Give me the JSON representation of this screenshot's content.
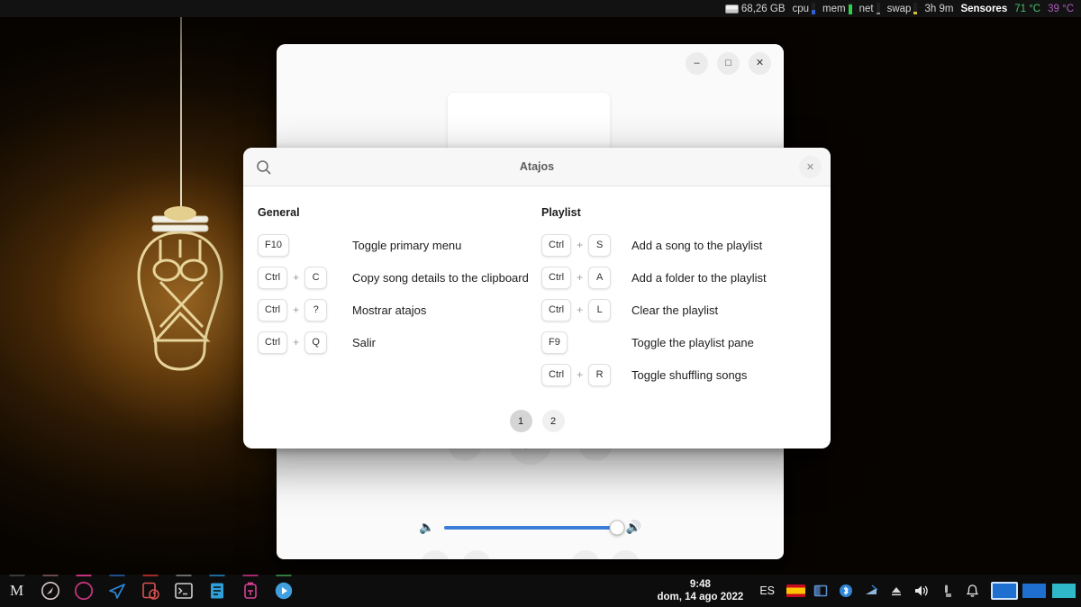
{
  "topbar": {
    "items": [
      {
        "name": "disk",
        "label": "68,26 GB",
        "color": "#d6d6d6",
        "bold": false,
        "graph": null
      },
      {
        "name": "cpu",
        "label": "cpu",
        "color": "#d6d6d6",
        "bold": false,
        "graph": "#2f5fd0"
      },
      {
        "name": "mem",
        "label": "mem",
        "color": "#d6d6d6",
        "bold": false,
        "graph": "#2fd04a"
      },
      {
        "name": "net",
        "label": "net",
        "color": "#d6d6d6",
        "bold": false,
        "graph": "#8a8a8a"
      },
      {
        "name": "swap",
        "label": "swap",
        "color": "#d6d6d6",
        "bold": false,
        "graph": "#d0c22f"
      },
      {
        "name": "uptime",
        "label": "3h 9m",
        "color": "#d6d6d6",
        "bold": false,
        "graph": null
      },
      {
        "name": "sensors",
        "label": "Sensores",
        "color": "#ffffff",
        "bold": true,
        "graph": null
      },
      {
        "name": "temp-cpu",
        "label": "71 °C",
        "color": "#4bbf6b",
        "bold": false,
        "graph": null
      },
      {
        "name": "temp-gpu",
        "label": "39 °C",
        "color": "#b05ec0",
        "bold": false,
        "graph": null
      }
    ]
  },
  "player": {
    "window_buttons": {
      "minimize": "–",
      "maximize": "□",
      "close": "✕"
    },
    "transport": {
      "previous": "⏮",
      "play": "▶",
      "next": "⏭"
    },
    "volume": {
      "low_icon": "🔈",
      "high_icon": "🔊",
      "value": 100
    },
    "bottom_buttons": [
      {
        "name": "sidebar-toggle",
        "glyph": "◧",
        "disabled": false
      },
      {
        "name": "equalizer",
        "glyph": "♩♩",
        "disabled": true
      },
      {
        "name": "shuffle",
        "glyph": "⇉",
        "disabled": false
      },
      {
        "name": "menu",
        "glyph": "☰",
        "disabled": false
      }
    ]
  },
  "shortcuts_dialog": {
    "title": "Atajos",
    "search_icon": "search-icon",
    "close_label": "✕",
    "columns": [
      {
        "title": "General",
        "rows": [
          {
            "keys": [
              "F10"
            ],
            "desc": "Toggle primary menu"
          },
          {
            "keys": [
              "Ctrl",
              "C"
            ],
            "desc": "Copy song details to the clipboard"
          },
          {
            "keys": [
              "Ctrl",
              "?"
            ],
            "desc": "Mostrar atajos"
          },
          {
            "keys": [
              "Ctrl",
              "Q"
            ],
            "desc": "Salir"
          }
        ]
      },
      {
        "title": "Playlist",
        "rows": [
          {
            "keys": [
              "Ctrl",
              "S"
            ],
            "desc": "Add a song to the playlist"
          },
          {
            "keys": [
              "Ctrl",
              "A"
            ],
            "desc": "Add a folder to the playlist"
          },
          {
            "keys": [
              "Ctrl",
              "L"
            ],
            "desc": "Clear the playlist"
          },
          {
            "keys": [
              "F9"
            ],
            "desc": "Toggle the playlist pane"
          },
          {
            "keys": [
              "Ctrl",
              "R"
            ],
            "desc": "Toggle shuffling songs"
          }
        ]
      }
    ],
    "pages": [
      {
        "label": "1",
        "active": true
      },
      {
        "label": "2",
        "active": false
      }
    ],
    "plus_symbol": "+"
  },
  "taskbar": {
    "launchers": [
      {
        "name": "launcher-m",
        "glyph": "M",
        "color": "#e8e8e8",
        "indicator": "#3a3a3a"
      },
      {
        "name": "launcher-compass",
        "glyph": "↗",
        "color": "#d8c6c6",
        "indicator": "#6a4a4a"
      },
      {
        "name": "launcher-firefox",
        "glyph": "◔",
        "color": "#e06a2b",
        "indicator": "#c2337a"
      },
      {
        "name": "launcher-telegram",
        "glyph": "➤",
        "color": "#2f86d8",
        "indicator": "#1d4f8a"
      },
      {
        "name": "launcher-recorder",
        "glyph": "⏺",
        "color": "#d85050",
        "indicator": "#a02a2a"
      },
      {
        "name": "launcher-terminal",
        "glyph": "⬛",
        "color": "#cfcfcf",
        "indicator": "#6b6b6b"
      },
      {
        "name": "launcher-editor",
        "glyph": "☰",
        "color": "#2f9fd8",
        "indicator": "#1d6a9a"
      },
      {
        "name": "launcher-flask",
        "glyph": "⚗",
        "color": "#d83f96",
        "indicator": "#a02a6a"
      },
      {
        "name": "launcher-player",
        "glyph": "▶",
        "color": "#3f9fe0",
        "indicator": "#2f7a3f"
      }
    ],
    "clock": {
      "time": "9:48",
      "date": "dom, 14 ago 2022"
    },
    "language": "ES",
    "tray": [
      {
        "name": "tray-clipboard",
        "glyph": "▤",
        "color": "#8a8a8a"
      },
      {
        "name": "tray-flag-spain",
        "glyph": "",
        "color": ""
      },
      {
        "name": "tray-window",
        "glyph": "◰",
        "color": "#5b8fd0"
      },
      {
        "name": "tray-bluetooth",
        "glyph": "ᛦ",
        "color": "#2f86d8"
      },
      {
        "name": "tray-network",
        "glyph": "◢",
        "color": "#6a9fd0"
      },
      {
        "name": "tray-eject",
        "glyph": "⏏",
        "color": "#d8d8d8"
      },
      {
        "name": "tray-volume",
        "glyph": "🔊",
        "color": "#e8e8e8"
      },
      {
        "name": "tray-device",
        "glyph": "❙",
        "color": "#b8b8b8"
      },
      {
        "name": "tray-notifications",
        "glyph": "🔔",
        "color": "#e8e8e8"
      }
    ],
    "workspaces": [
      {
        "name": "workspace-1",
        "color": "#1f6fd0",
        "active": true
      },
      {
        "name": "workspace-2",
        "color": "#1f6fd0",
        "active": false
      },
      {
        "name": "workspace-3",
        "color": "#2fb8c8",
        "active": false
      }
    ]
  }
}
